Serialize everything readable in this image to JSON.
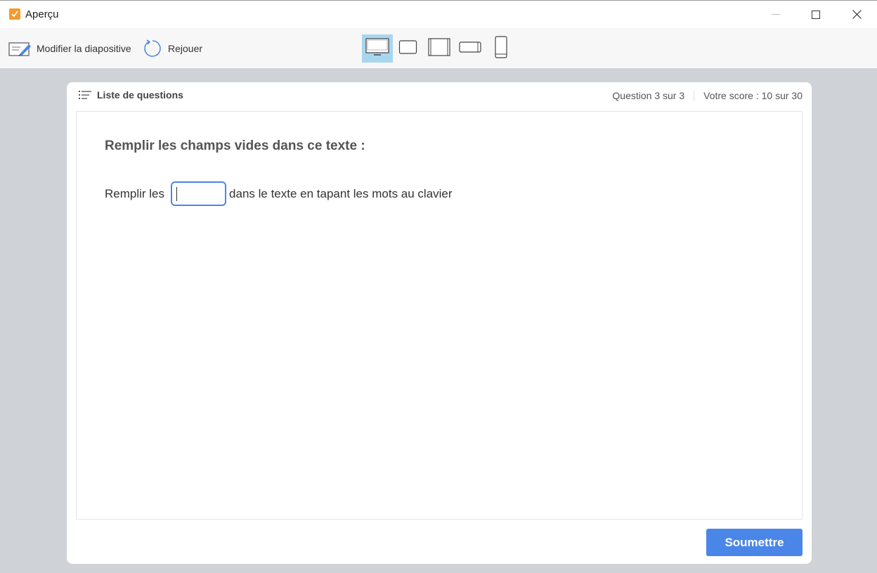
{
  "window": {
    "title": "Aperçu"
  },
  "toolbar": {
    "edit_label": "Modifier la diapositive",
    "replay_label": "Rejouer",
    "devices": [
      {
        "name": "desktop",
        "active": true
      },
      {
        "name": "tablet-landscape",
        "active": false
      },
      {
        "name": "tablet-portrait",
        "active": false
      },
      {
        "name": "phone-landscape",
        "active": false
      },
      {
        "name": "phone-portrait",
        "active": false
      }
    ]
  },
  "header": {
    "question_list_label": "Liste de questions",
    "question_progress": "Question 3 sur 3",
    "score": "Votre score : 10 sur 30"
  },
  "question": {
    "title": "Remplir les champs vides dans ce texte :",
    "text_before": "Remplir les",
    "blank_value": "",
    "text_after": "dans le texte en tapant les mots au clavier"
  },
  "footer": {
    "submit_label": "Soumettre"
  },
  "colors": {
    "accent": "#4a86e8",
    "app_icon": "#f39c2b",
    "active_device": "#a9d6ef",
    "backdrop": "#cfd3d7"
  }
}
